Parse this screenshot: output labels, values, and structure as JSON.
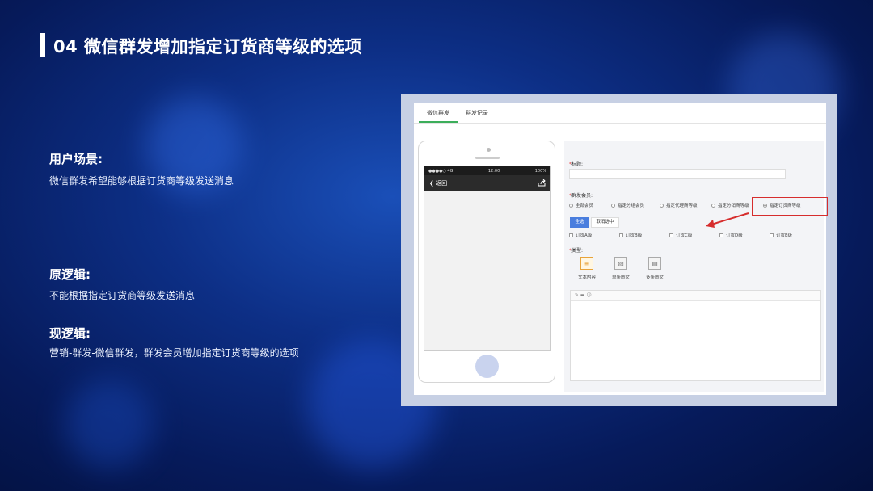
{
  "slide": {
    "title": "04 微信群发增加指定订货商等级的选项",
    "sections": [
      {
        "heading": "用户场景:",
        "text": "微信群发希望能够根据订货商等级发送消息"
      },
      {
        "heading": "原逻辑:",
        "text": "不能根据指定订货商等级发送消息"
      },
      {
        "heading": "现逻辑:",
        "text": "营销-群发-微信群发，群发会员增加指定订货商等级的选项"
      }
    ]
  },
  "screenshot": {
    "tabs": [
      {
        "label": "微信群发",
        "active": true
      },
      {
        "label": "群发记录",
        "active": false
      }
    ],
    "phone": {
      "carrier": "●●●●○ 4G",
      "time": "12:00",
      "battery": "100%",
      "back_label": "返回",
      "back_icon": "chevron-left-icon",
      "share_icon": "share-icon"
    },
    "form": {
      "title_label": "标题:",
      "members_label": "群发会员:",
      "member_options": [
        {
          "label": "全部会员",
          "checked": false
        },
        {
          "label": "指定分组会员",
          "checked": false
        },
        {
          "label": "指定代理商等级",
          "checked": false
        },
        {
          "label": "指定分销商等级",
          "checked": false
        },
        {
          "label": "指定订货商等级",
          "checked": true
        }
      ],
      "select_all_button": "全选",
      "deselect_button": "取消选中",
      "levels": [
        "订货A级",
        "订货B级",
        "订货C级",
        "订货D级",
        "订货E级"
      ],
      "type_label": "类型:",
      "types": [
        {
          "label": "文本内容",
          "icon": "text-lines-icon",
          "selected": true
        },
        {
          "label": "单条图文",
          "icon": "single-article-icon",
          "selected": false
        },
        {
          "label": "多条图文",
          "icon": "multi-article-icon",
          "selected": false
        }
      ],
      "editor_toolbar": "✎ ▬ ☺"
    },
    "highlight_color": "#d62d2d",
    "accent_color": "#4a7ede",
    "tab_active_color": "#3cae5a"
  }
}
